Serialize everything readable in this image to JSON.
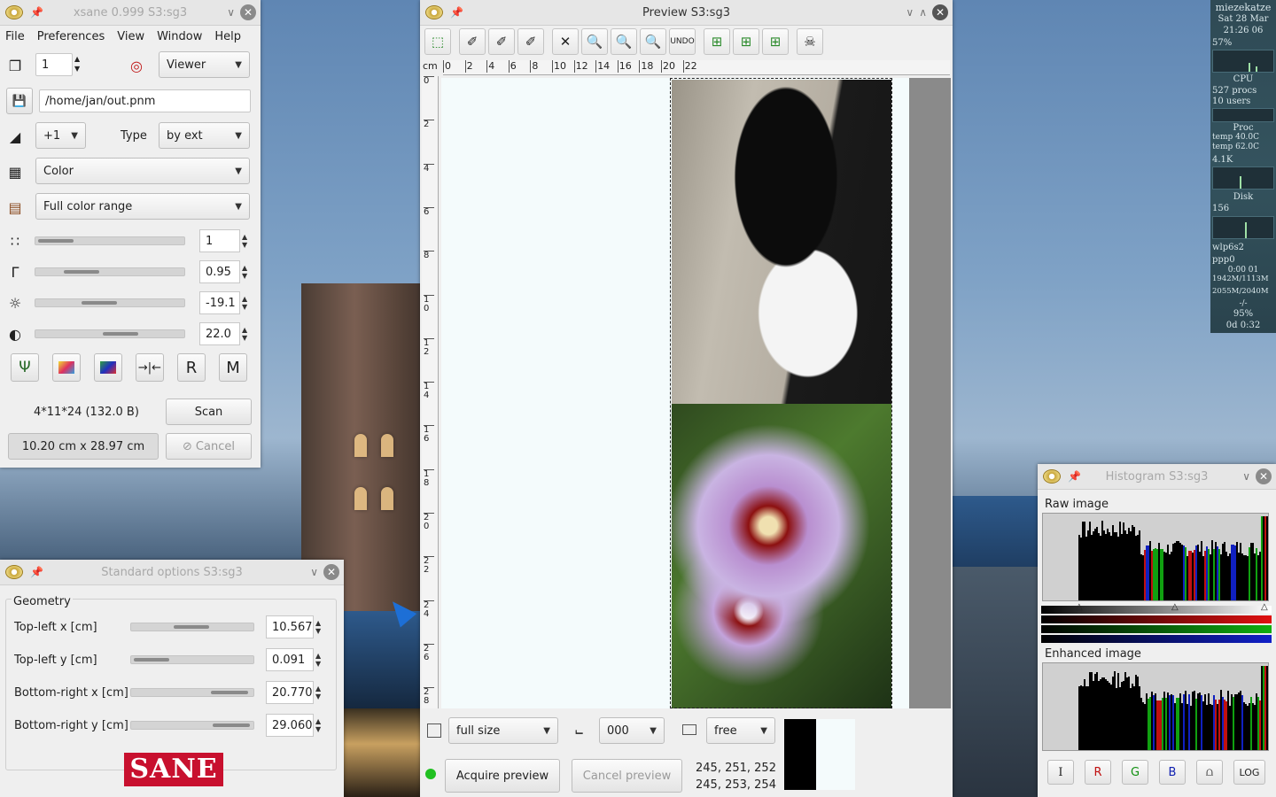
{
  "xsane": {
    "title": "xsane 0.999 S3:sg3",
    "menu": [
      "File",
      "Preferences",
      "View",
      "Window",
      "Help"
    ],
    "copies": "1",
    "mode": "Viewer",
    "filename": "/home/jan/out.pnm",
    "step": "+1",
    "type_label": "Type",
    "type_value": "by ext",
    "color_mode": "Color",
    "range": "Full color range",
    "resolution": "1",
    "gamma": "0.95",
    "brightness": "-19.1",
    "contrast": "22.0",
    "info": "4*11*24 (132.0 B)",
    "scan_label": "Scan",
    "size": "10.20 cm x 28.97 cm",
    "cancel_label": "Cancel"
  },
  "stdopts": {
    "title": "Standard options S3:sg3",
    "group": "Geometry",
    "rows": [
      {
        "label": "Top-left x [cm]",
        "value": "10.567"
      },
      {
        "label": "Top-left y [cm]",
        "value": "0.091"
      },
      {
        "label": "Bottom-right x [cm]",
        "value": "20.770"
      },
      {
        "label": "Bottom-right y [cm]",
        "value": "29.060"
      }
    ],
    "logo": "SANE"
  },
  "preview": {
    "title": "Preview S3:sg3",
    "ruler_unit": "cm",
    "hruler_ticks": [
      "0",
      "2",
      "4",
      "6",
      "8",
      "10",
      "12",
      "14",
      "16",
      "18",
      "20",
      "22"
    ],
    "vruler_ticks": [
      "0",
      "2",
      "4",
      "6",
      "8",
      "10",
      "12",
      "14",
      "16",
      "18",
      "20",
      "22",
      "24",
      "26",
      "28"
    ],
    "zoom": "full size",
    "rotation": "000",
    "ratio": "free",
    "acquire_label": "Acquire preview",
    "cancel_label": "Cancel preview",
    "rgb1": "245, 251, 252",
    "rgb2": "245, 253, 254"
  },
  "histogram": {
    "title": "Histogram S3:sg3",
    "raw_label": "Raw image",
    "enhanced_label": "Enhanced image",
    "buttons": [
      "I",
      "R",
      "G",
      "B",
      "LOG"
    ]
  },
  "gkrellm": {
    "host": "miezekatze",
    "date": "Sat 28 Mar",
    "time": "21:26 06",
    "pct1": "57%",
    "cpu": "CPU",
    "procs": "527 procs",
    "users": "10 users",
    "proc": "Proc",
    "temp1": "temp    40.0C",
    "temp2": "temp    62.0C",
    "mem": "4.1K",
    "disk": "Disk",
    "disk_val": "156",
    "net1": "wlp6s2",
    "net2": "ppp0",
    "uptime_small": "0:00  01",
    "rx": "1942M/1113M",
    "tx": "2055M/2040M",
    "batt_sep": "-/-",
    "batt": "95%",
    "batt_time": "0d  0:32"
  },
  "colors": {
    "accent_red": "#e01010",
    "accent_green": "#10b010",
    "accent_blue": "#1020c8",
    "status_green": "#20c020"
  }
}
